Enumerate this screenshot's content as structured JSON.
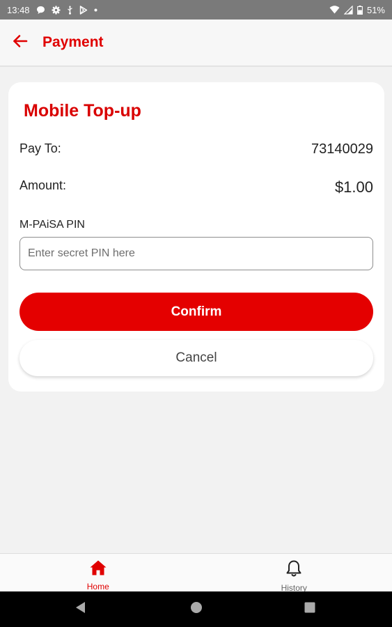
{
  "status_bar": {
    "time": "13:48",
    "battery": "51%"
  },
  "app_bar": {
    "title": "Payment"
  },
  "card": {
    "title": "Mobile Top-up",
    "pay_to_label": "Pay To:",
    "pay_to_value": "73140029",
    "amount_label": "Amount:",
    "amount_value": "$1.00",
    "pin_label": "M-PAiSA PIN",
    "pin_placeholder": "Enter secret PIN here",
    "confirm_label": "Confirm",
    "cancel_label": "Cancel"
  },
  "bottom_nav": {
    "items": [
      {
        "label": "Home",
        "icon": "home-icon",
        "active": true
      },
      {
        "label": "History",
        "icon": "bell-icon",
        "active": false
      }
    ]
  },
  "colors": {
    "accent": "#e00000",
    "background": "#f2f2f2",
    "card": "#ffffff"
  }
}
